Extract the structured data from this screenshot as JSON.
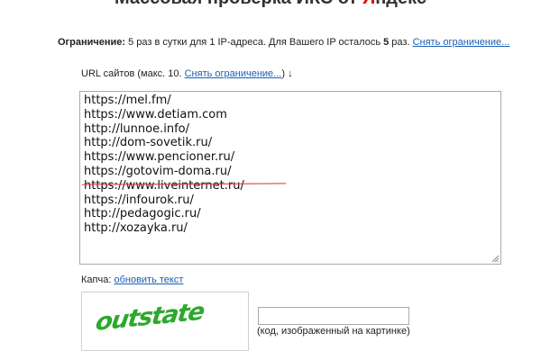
{
  "header": {
    "title_prefix": "Массовая проверка ИКС от ",
    "title_brand_first": "Я",
    "title_brand_rest": "ндекс"
  },
  "limit": {
    "label": "Ограничение:",
    "text": " 5 раз в сутки для 1 IP-адреса. Для Вашего IP осталось ",
    "remaining": "5",
    "suffix": " раз. ",
    "remove_link": "Снять ограничение..."
  },
  "urls": {
    "label": "URL сайтов (макс. 10. ",
    "remove_link": "Снять ограничение...",
    "label_suffix": ") ↓",
    "list": [
      "https://mel.fm/",
      "https://www.detiam.com",
      "http://lunnoe.info/",
      "http://dom-sovetik.ru/",
      "https://www.pencioner.ru/",
      "https://gotovim-doma.ru/",
      "https://www.liveinternet.ru/",
      "https://infourok.ru/",
      "http://pedagogic.ru/",
      "http://xozayka.ru/"
    ],
    "struck_color": "#e12c2c"
  },
  "captcha": {
    "label": "Капча: ",
    "refresh_link": "обновить текст",
    "image_text": "outstate",
    "image_color": "#2ea82e",
    "input_value": "",
    "hint": "(код, изображенный на картинке)"
  }
}
